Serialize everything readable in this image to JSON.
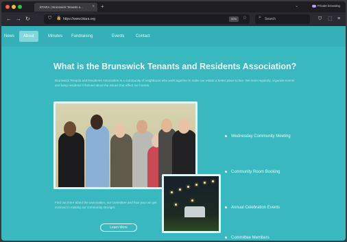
{
  "browser": {
    "tab_title": "BTARA | Brunswick Tenants a...",
    "tab_close": "×",
    "new_tab": "+",
    "private_label": "Private browsing",
    "url": "https://www.btara.org",
    "url_badge": "90%",
    "search_placeholder": "Search"
  },
  "nav": {
    "items": [
      "News",
      "About",
      "Minutes",
      "Fundraising",
      "Events",
      "Contact"
    ],
    "active": "About"
  },
  "main": {
    "title": "What is the Brunswick Tenants and Residents Association?",
    "intro": "Brunswick Tenants and Residents Association is a community of neighbours who work together to make our estate a better place to live. We meet regularly, organise events and keep residents informed about the issues that affect our homes.",
    "list": [
      "Wednesday Community Meeting",
      "Community Room Booking",
      "Annual Celebration Events",
      "Committee Members"
    ],
    "bottom_text": "Find out more about the association, our committee and how you can get involved in making our community stronger.",
    "learn_more": "Learn More"
  }
}
